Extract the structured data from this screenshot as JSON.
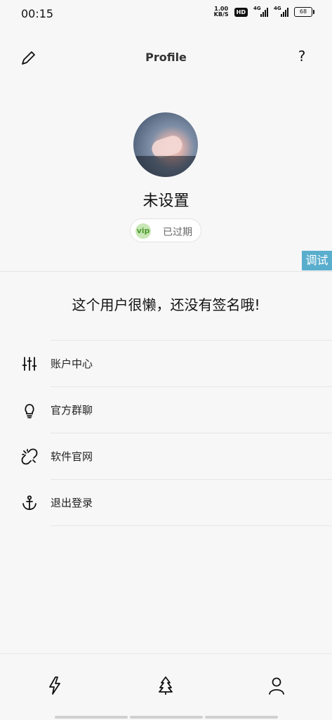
{
  "status_bar": {
    "time": "00:15",
    "speed_value": "1.00",
    "speed_unit": "KB/S",
    "hd_label": "HD",
    "network1": "4G",
    "network2": "4G",
    "battery": "68"
  },
  "header": {
    "title": "Profile",
    "help_label": "?"
  },
  "profile": {
    "username": "未设置",
    "vip_label": "vip",
    "vip_status": "已过期",
    "signature": "这个用户很懒，还没有签名哦!"
  },
  "debug_label": "调试",
  "menu": [
    {
      "label": "账户中心",
      "icon": "sliders-icon"
    },
    {
      "label": "官方群聊",
      "icon": "lightbulb-icon"
    },
    {
      "label": "软件官网",
      "icon": "link-broken-icon"
    },
    {
      "label": "退出登录",
      "icon": "anchor-icon"
    }
  ],
  "bottom_nav": [
    {
      "icon": "lightning-icon"
    },
    {
      "icon": "tree-icon"
    },
    {
      "icon": "user-icon"
    }
  ]
}
